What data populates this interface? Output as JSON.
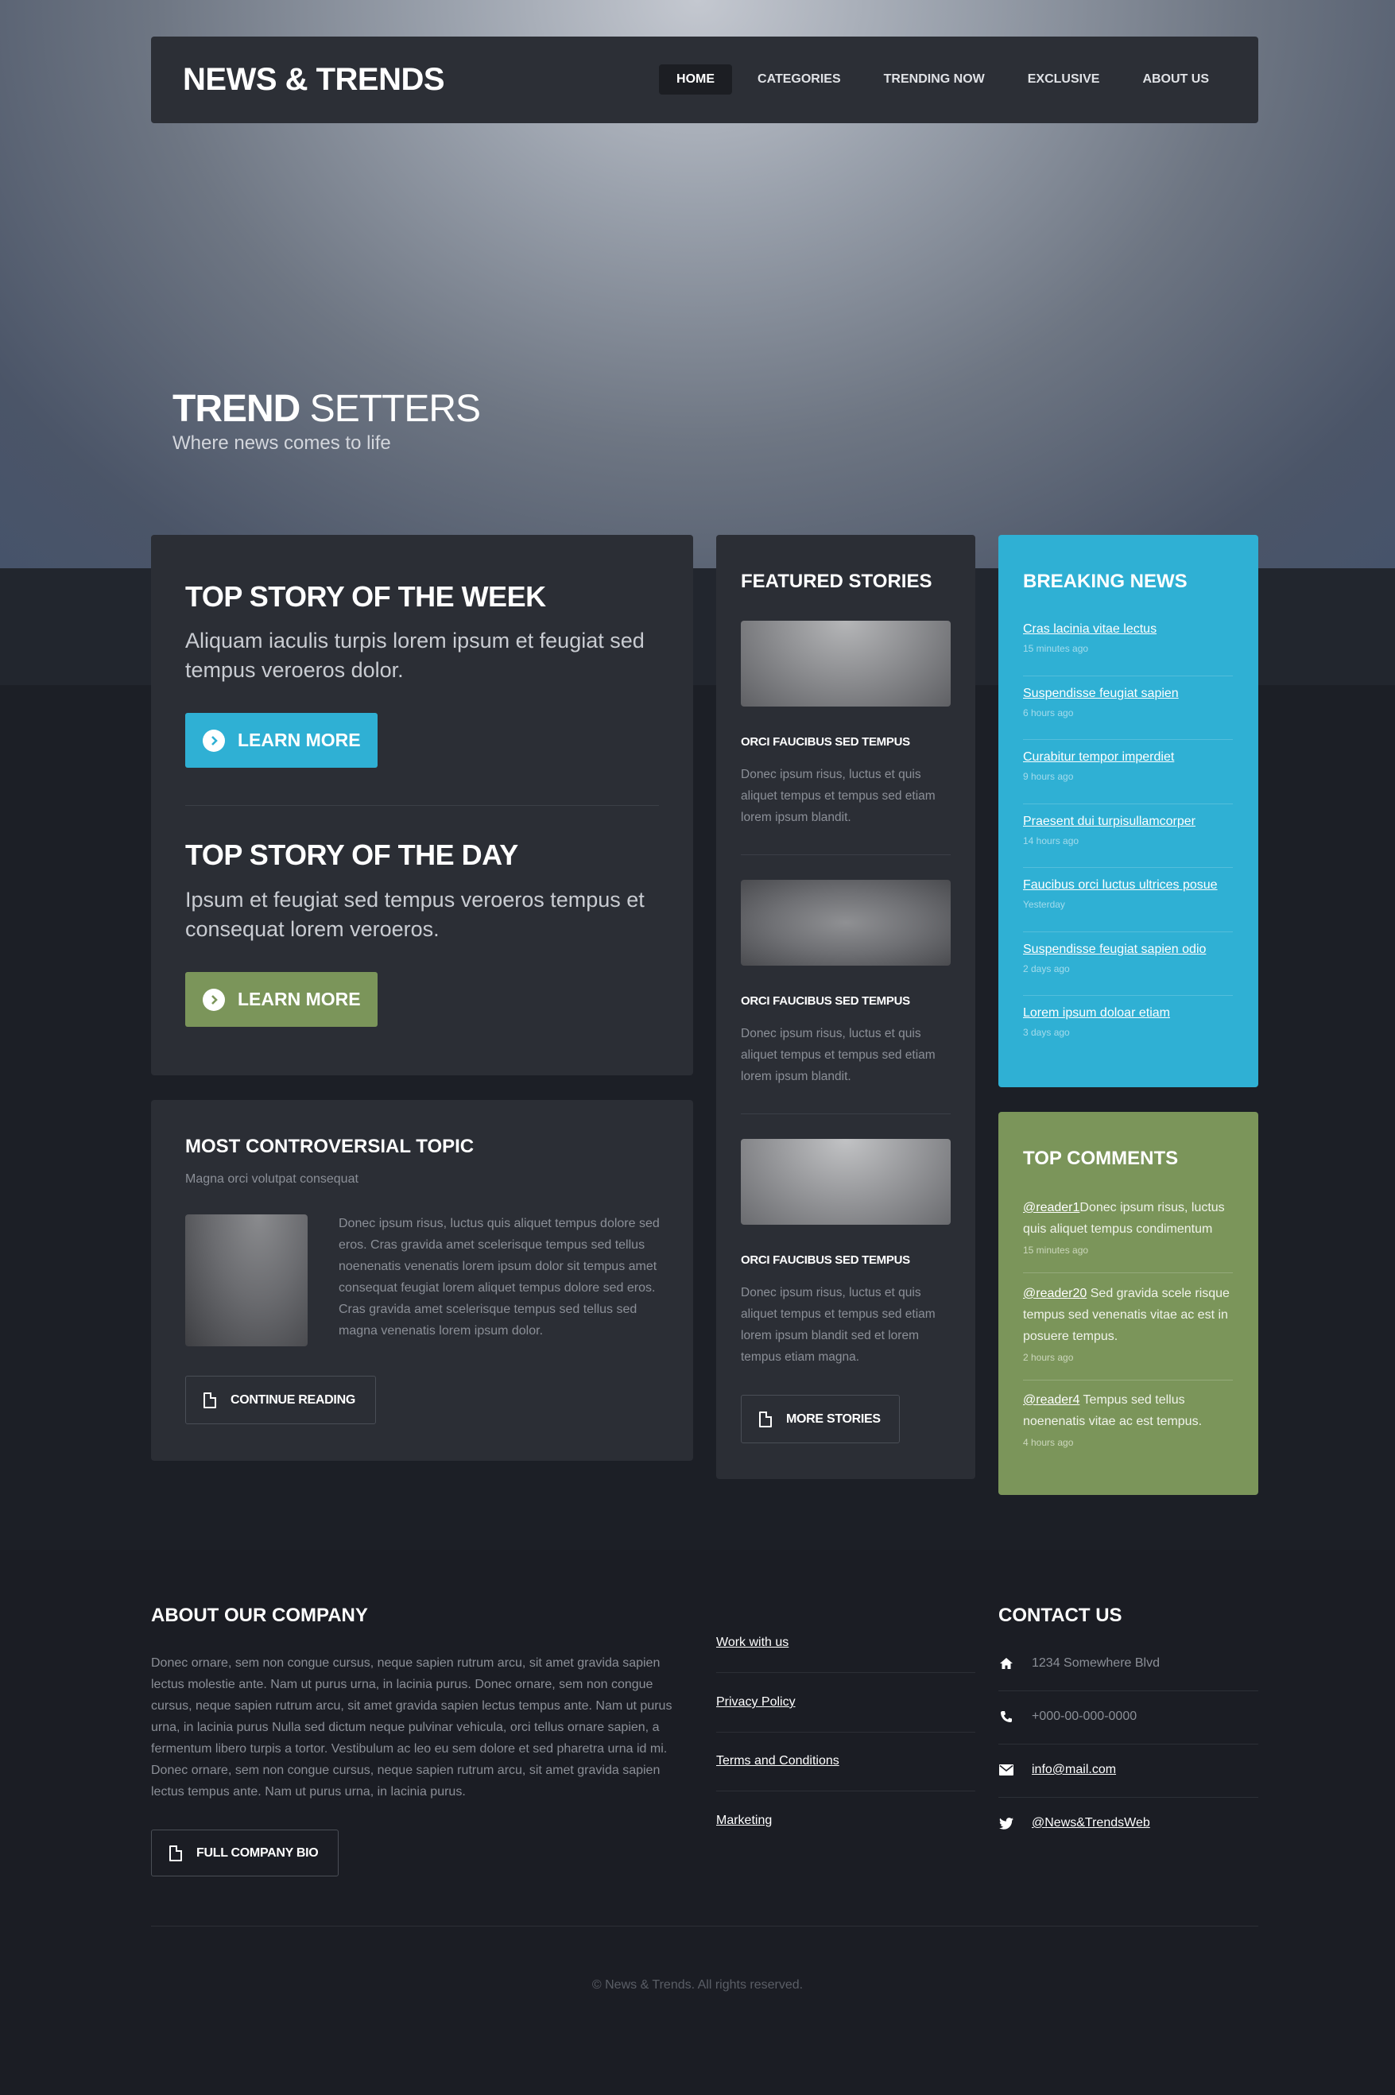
{
  "header": {
    "logo": "NEWS & TRENDS",
    "nav": [
      "HOME",
      "CATEGORIES",
      "TRENDING NOW",
      "EXCLUSIVE",
      "ABOUT US"
    ]
  },
  "hero": {
    "title_bold": "TREND",
    "title_light": "SETTERS",
    "subtitle": "Where news comes to life"
  },
  "top_stories": {
    "week": {
      "title": "TOP STORY OF THE WEEK",
      "text": "Aliquam iaculis turpis lorem ipsum et feugiat sed tempus veroeros dolor.",
      "button": "LEARN MORE"
    },
    "day": {
      "title": "TOP STORY OF THE DAY",
      "text": "Ipsum et feugiat sed tempus veroeros tempus et consequat lorem veroeros.",
      "button": "LEARN MORE"
    }
  },
  "controversial": {
    "title": "MOST CONTROVERSIAL TOPIC",
    "subtitle": "Magna orci volutpat consequat",
    "text": "Donec ipsum risus, luctus quis aliquet tempus dolore sed eros. Cras gravida amet scelerisque tempus sed tellus noenenatis venenatis lorem ipsum dolor sit tempus amet consequat feugiat lorem aliquet tempus dolore sed eros. Cras gravida amet scelerisque tempus sed tellus sed magna venenatis lorem ipsum dolor.",
    "button": "CONTINUE READING"
  },
  "featured": {
    "title": "FEATURED STORIES",
    "items": [
      {
        "title": "ORCI FAUCIBUS SED TEMPUS",
        "text": "Donec ipsum risus, luctus et quis aliquet tempus et tempus sed etiam lorem ipsum blandit."
      },
      {
        "title": "ORCI FAUCIBUS SED TEMPUS",
        "text": "Donec ipsum risus, luctus et quis aliquet tempus et tempus sed etiam lorem ipsum blandit."
      },
      {
        "title": "ORCI FAUCIBUS SED TEMPUS",
        "text": "Donec ipsum risus, luctus et quis aliquet tempus et tempus sed etiam lorem ipsum blandit sed et lorem tempus etiam magna."
      }
    ],
    "button": "MORE STORIES"
  },
  "breaking": {
    "title": "BREAKING NEWS",
    "items": [
      {
        "link": "Cras lacinia vitae lectus",
        "time": "15 minutes ago"
      },
      {
        "link": "Suspendisse feugiat sapien",
        "time": "6 hours ago"
      },
      {
        "link": "Curabitur tempor imperdiet",
        "time": "9 hours ago"
      },
      {
        "link": "Praesent dui turpisullamcorper",
        "time": "14 hours ago"
      },
      {
        "link": "Faucibus orci luctus ultrices posue",
        "time": "Yesterday"
      },
      {
        "link": "Suspendisse feugiat sapien odio",
        "time": "2 days ago"
      },
      {
        "link": "Lorem ipsum doloar etiam",
        "time": "3 days ago"
      }
    ]
  },
  "comments": {
    "title": "TOP COMMENTS",
    "items": [
      {
        "user": "@reader1",
        "text": "Donec ipsum risus, luctus quis aliquet tempus condimentum",
        "time": "15 minutes ago"
      },
      {
        "user": "@reader20",
        "text": " Sed gravida scele risque tempus sed venenatis vitae ac est in posuere tempus.",
        "time": "2 hours ago"
      },
      {
        "user": "@reader4",
        "text": " Tempus sed tellus noenenatis vitae ac est tempus.",
        "time": "4 hours ago"
      }
    ]
  },
  "footer": {
    "about_title": "ABOUT OUR COMPANY",
    "about_text": "Donec ornare, sem non congue cursus, neque sapien rutrum arcu, sit amet gravida sapien lectus molestie ante. Nam ut purus urna, in lacinia purus. Donec ornare, sem non congue cursus, neque sapien rutrum arcu, sit amet gravida sapien lectus tempus ante. Nam ut purus urna, in lacinia purus Nulla sed dictum neque pulvinar vehicula, orci tellus ornare sapien, a fermentum libero turpis a tortor. Vestibulum ac leo eu sem dolore et sed pharetra urna id mi. Donec ornare, sem non congue cursus, neque sapien rutrum arcu, sit amet gravida sapien lectus tempus ante. Nam ut purus urna, in lacinia purus.",
    "about_button": "FULL COMPANY BIO",
    "links": [
      "Work with us",
      "Privacy Policy",
      "Terms and Conditions",
      "Marketing"
    ],
    "contact_title": "CONTACT US",
    "address": "1234 Somewhere Blvd",
    "phone": "+000-00-000-0000",
    "email": "info@mail.com",
    "twitter": "@News&TrendsWeb",
    "copyright": "© News & Trends. All rights reserved."
  }
}
